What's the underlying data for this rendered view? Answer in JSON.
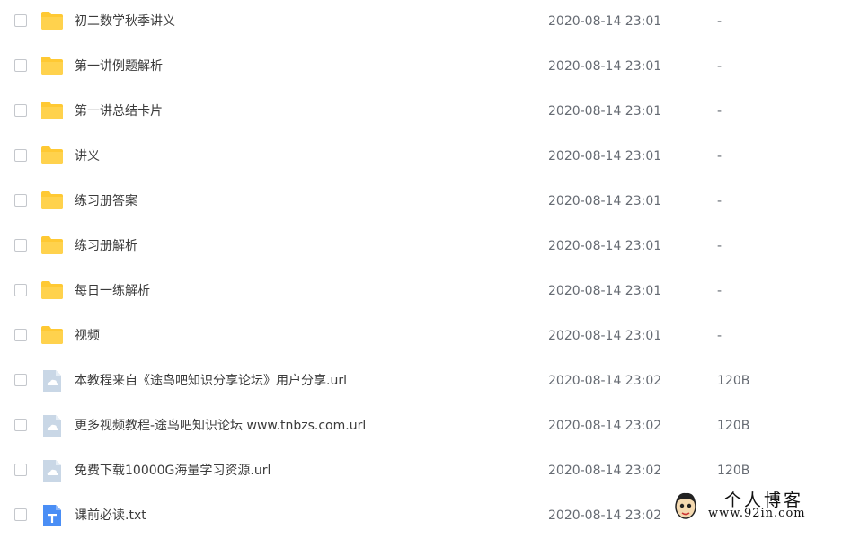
{
  "files": [
    {
      "name": "初二数学秋季讲义",
      "date": "2020-08-14 23:01",
      "size": "-",
      "icon": "folder-icon"
    },
    {
      "name": "第一讲例题解析",
      "date": "2020-08-14 23:01",
      "size": "-",
      "icon": "folder-icon"
    },
    {
      "name": "第一讲总结卡片",
      "date": "2020-08-14 23:01",
      "size": "-",
      "icon": "folder-icon"
    },
    {
      "name": "讲义",
      "date": "2020-08-14 23:01",
      "size": "-",
      "icon": "folder-icon"
    },
    {
      "name": "练习册答案",
      "date": "2020-08-14 23:01",
      "size": "-",
      "icon": "folder-icon"
    },
    {
      "name": "练习册解析",
      "date": "2020-08-14 23:01",
      "size": "-",
      "icon": "folder-icon"
    },
    {
      "name": "每日一练解析",
      "date": "2020-08-14 23:01",
      "size": "-",
      "icon": "folder-icon"
    },
    {
      "name": "视频",
      "date": "2020-08-14 23:01",
      "size": "-",
      "icon": "folder-icon"
    },
    {
      "name": "本教程来自《途鸟吧知识分享论坛》用户分享.url",
      "date": "2020-08-14 23:02",
      "size": "120B",
      "icon": "link-file-icon"
    },
    {
      "name": "更多视频教程-途鸟吧知识论坛 www.tnbzs.com.url",
      "date": "2020-08-14 23:02",
      "size": "120B",
      "icon": "link-file-icon"
    },
    {
      "name": "免费下载10000G海量学习资源.url",
      "date": "2020-08-14 23:02",
      "size": "120B",
      "icon": "link-file-icon"
    },
    {
      "name": "课前必读.txt",
      "date": "2020-08-14 23:02",
      "size": "",
      "icon": "text-file-icon"
    }
  ],
  "colors": {
    "folder": "#ffc933",
    "link_file": "#c9d7e6",
    "text_file": "#4a8ef5"
  },
  "watermark": {
    "title": "个人博客",
    "url": "www.92in.com"
  }
}
